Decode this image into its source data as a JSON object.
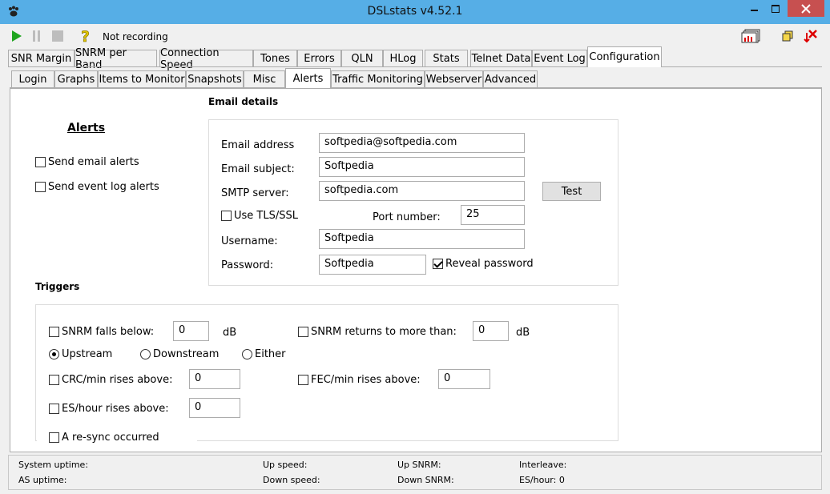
{
  "window": {
    "title": "DSLstats v4.52.1"
  },
  "toolbar": {
    "status": "Not recording"
  },
  "main_tabs": [
    "SNR Margin",
    "SNRM per Band",
    "Connection Speed",
    "Tones",
    "Errors",
    "QLN",
    "HLog",
    "Stats",
    "Telnet Data",
    "Event Log",
    "Configuration"
  ],
  "sub_tabs": [
    "Login",
    "Graphs",
    "Items to Monitor",
    "Snapshots",
    "Misc",
    "Alerts",
    "Traffic Monitoring",
    "Webserver",
    "Advanced"
  ],
  "alerts": {
    "heading": "Alerts",
    "send_email": "Send email alerts",
    "send_event_log": "Send event log alerts"
  },
  "email": {
    "heading": "Email details",
    "address_label": "Email address",
    "address_value": "softpedia@softpedia.com",
    "subject_label": "Email subject:",
    "subject_value": "Softpedia",
    "smtp_label": "SMTP server:",
    "smtp_value": "softpedia.com",
    "test_button": "Test",
    "tls_label": "Use TLS/SSL",
    "port_label": "Port number:",
    "port_value": "25",
    "username_label": "Username:",
    "username_value": "Softpedia",
    "password_label": "Password:",
    "password_value": "Softpedia",
    "reveal_label": "Reveal password"
  },
  "triggers": {
    "heading": "Triggers",
    "snrm_below_label": "SNRM falls below:",
    "snrm_below_value": "0",
    "snrm_below_unit": "dB",
    "snrm_above_label": "SNRM returns to more than:",
    "snrm_above_value": "0",
    "snrm_above_unit": "dB",
    "upstream": "Upstream",
    "downstream": "Downstream",
    "either": "Either",
    "crc_label": "CRC/min rises above:",
    "crc_value": "0",
    "fec_label": "FEC/min rises above:",
    "fec_value": "0",
    "es_label": "ES/hour rises above:",
    "es_value": "0",
    "resync_label": "A re-sync occurred"
  },
  "statusbar": {
    "system_uptime": "System uptime:",
    "as_uptime": "AS uptime:",
    "up_speed": "Up speed:",
    "down_speed": "Down speed:",
    "up_snrm": "Up SNRM:",
    "down_snrm": "Down SNRM:",
    "interleave": "Interleave:",
    "es_hour": "ES/hour: 0"
  },
  "colors": {
    "titlebar": "#56aee6",
    "close": "#c75050",
    "play": "#1fa51f"
  }
}
